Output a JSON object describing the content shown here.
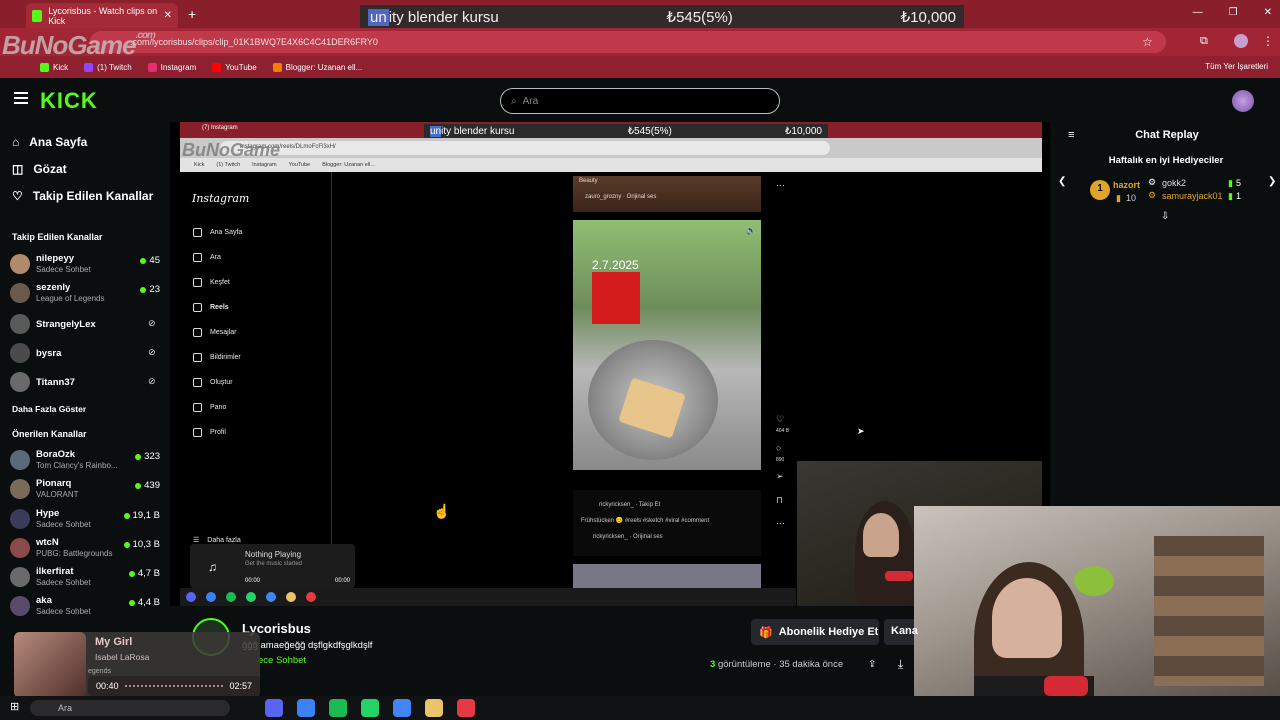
{
  "browser": {
    "tab_title": "Lycorisbus - Watch clips on Kick",
    "new_tab": "+",
    "url": ".com/lycorisbus/clips/clip_01K1BWQ7E4X6C4C41DER6FRY0",
    "watermark": "BuNoGame",
    "watermark_suffix": ".com",
    "bookmarks": [
      {
        "label": "Kick",
        "color": "#53fc18"
      },
      {
        "label": "(1) Twitch",
        "color": "#9146ff"
      },
      {
        "label": "Instagram",
        "color": "#e1306c"
      },
      {
        "label": "YouTube",
        "color": "#ff0000"
      },
      {
        "label": "Blogger: Uzanan ell...",
        "color": "#f57d00"
      }
    ],
    "all_bookmarks": "Tüm Yer İşaretleri"
  },
  "stream_overlay": {
    "goal_label": "unity blender kursu",
    "goal_highlight": "un",
    "goal_rest": "ity blender kursu",
    "current": "₺545(5%)",
    "target": "₺10,000"
  },
  "kick": {
    "logo": "KICK",
    "search_placeholder": "Ara",
    "nav": [
      {
        "label": "Ana Sayfa",
        "icon": "home-icon"
      },
      {
        "label": "Gözat",
        "icon": "browse-icon"
      },
      {
        "label": "Takip Edilen Kanallar",
        "icon": "heart-icon"
      }
    ],
    "followed_title": "Takip Edilen Kanallar",
    "followed": [
      {
        "name": "nilepeyy",
        "sub": "Sadece Sohbet",
        "viewers": "45",
        "color": "#b08a6a"
      },
      {
        "name": "sezenly",
        "sub": "League of Legends",
        "viewers": "23",
        "color": "#6a5a4a"
      },
      {
        "name": "StrangelyLex",
        "sub": "",
        "viewers": "",
        "color": "#5a5a5a"
      },
      {
        "name": "bysra",
        "sub": "",
        "viewers": "",
        "color": "#4a4a4a"
      },
      {
        "name": "Titann37",
        "sub": "",
        "viewers": "",
        "color": "#6a6a6a"
      }
    ],
    "show_more": "Daha Fazla Göster",
    "recommended_title": "Önerilen Kanallar",
    "recommended": [
      {
        "name": "BoraOzk",
        "sub": "Tom Clancy's Rainbo...",
        "viewers": "323",
        "color": "#5a6a7a"
      },
      {
        "name": "Pionarq",
        "sub": "VALORANT",
        "viewers": "439",
        "color": "#7a6a5a"
      },
      {
        "name": "Hype",
        "sub": "Sadece Sohbet",
        "viewers": "19,1 B",
        "color": "#3a3a5a"
      },
      {
        "name": "wtcN",
        "sub": "PUBG: Battlegrounds",
        "viewers": "10,3 B",
        "color": "#8a4a4a"
      },
      {
        "name": "ilkerfirat",
        "sub": "Sadece Sohbet",
        "viewers": "4,7 B",
        "color": "#6a6a6a"
      },
      {
        "name": "aka",
        "sub": "Sadece Sohbet",
        "viewers": "4,4 B",
        "color": "#5a4a6a"
      }
    ]
  },
  "instagram": {
    "url": "instagram.com/reels/DLmoFcFl3xH/",
    "tab": "(7) Instagram",
    "logo": "Instagram",
    "nav": [
      "Ana Sayfa",
      "Ara",
      "Keşfet",
      "Reels",
      "Mesajlar",
      "Bildirimler",
      "Oluştur",
      "Pano",
      "Profil"
    ],
    "more": "Daha fazla",
    "reel_top_label": "Beauty",
    "reel_top_audio": "zauro_grozny · Orijinal ses",
    "reel_date": "2.7.2025",
    "reel_user": "rickyricksen_ · Takip Et",
    "reel_caption": "Frühstücken 😊 #reels #sketch #viral #comment",
    "reel_audio": "rickyricksen_ · Orijinal ses",
    "likes": "404 B",
    "comments": "890",
    "player_title": "Nothing Playing",
    "player_sub": "Get the music started",
    "player_time_start": "00:00",
    "player_time_end": "00:00"
  },
  "chat": {
    "title": "Chat Replay",
    "gifters_title": "Haftalık en iyi Hediyeciler",
    "gifters": [
      {
        "rank": "1",
        "name": "hazort",
        "count": "10"
      },
      {
        "name": "gokk2",
        "count": "5"
      },
      {
        "name": "samurayjack01",
        "count": "1"
      }
    ]
  },
  "clip": {
    "channel": "Lycorisbus",
    "title": "ğğğ amaeğeğğ dşflgkdfşglkdşlf",
    "category": "ece Sohbet",
    "subscribe": "Abonelik Hediye Et",
    "channel_btn": "Kana",
    "views_count": "3",
    "views_rest": "görüntüleme · 35 dakika önce"
  },
  "now_playing": {
    "title": "My Girl",
    "artist": "Isabel LaRosa",
    "time_start": "00:40",
    "time_end": "02:57",
    "behind_text": "egends"
  },
  "taskbar": {
    "search": "Ara",
    "apps": [
      "#5865f2",
      "#3b82f6",
      "#1db954",
      "#25d366",
      "#4285f4",
      "#e9c46a",
      "#e63946"
    ]
  }
}
